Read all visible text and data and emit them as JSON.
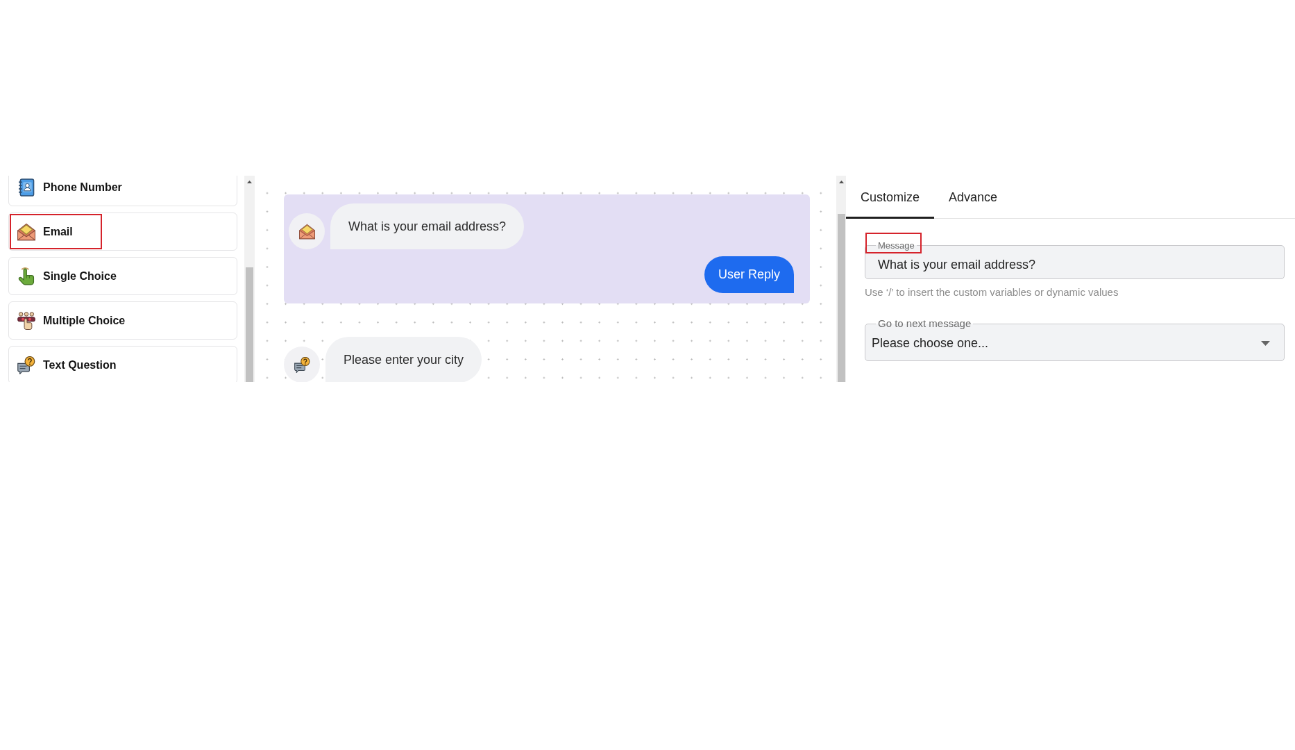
{
  "sidebar": {
    "items": [
      {
        "kind": "contact",
        "label": "Phone Number",
        "highlighted": false
      },
      {
        "kind": "email",
        "label": "Email",
        "highlighted": true
      },
      {
        "kind": "single_choice",
        "label": "Single Choice",
        "highlighted": false
      },
      {
        "kind": "multiple_choice",
        "label": "Multiple Choice",
        "highlighted": false
      },
      {
        "kind": "text_question",
        "label": "Text Question",
        "highlighted": false
      }
    ]
  },
  "canvas": {
    "nodes": [
      {
        "kind": "email",
        "message": "What is your email address?",
        "selected": true,
        "reply": "User Reply"
      },
      {
        "kind": "text_question",
        "message": "Please enter your city",
        "selected": false
      }
    ]
  },
  "panel": {
    "tabs": [
      {
        "label": "Customize",
        "selected": true
      },
      {
        "label": "Advance",
        "selected": false
      }
    ],
    "message_field": {
      "label": "Message",
      "value": "What is your email address?",
      "highlighted": true
    },
    "hint": "Use ‘/’ to insert the custom variables or dynamic values",
    "next_message": {
      "label": "Go to next message",
      "value": "Please choose one..."
    }
  }
}
